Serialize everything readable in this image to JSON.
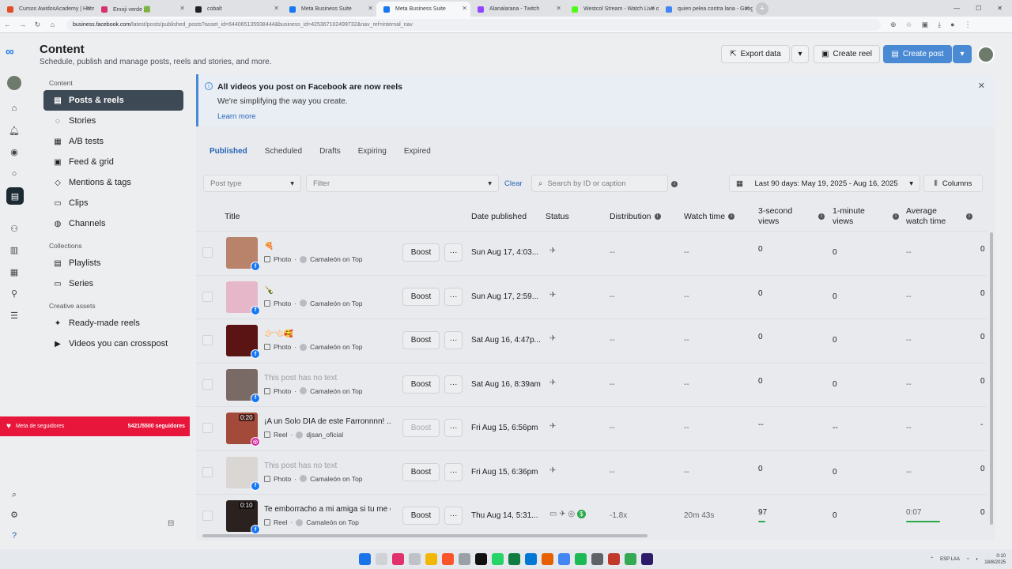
{
  "browser": {
    "tabs": [
      {
        "title": "Cursos AwidosAcademy | Hotm",
        "color": "#e34c26"
      },
      {
        "title": "Emoji verde 🟩",
        "color": "#d6336c"
      },
      {
        "title": "cobalt",
        "color": "#222222"
      },
      {
        "title": "Meta Business Suite",
        "color": "#1877f2"
      },
      {
        "title": "Meta Business Suite",
        "color": "#1877f2",
        "active": true
      },
      {
        "title": "Alanalarana - Twitch",
        "color": "#9146ff"
      },
      {
        "title": "Westcol Stream - Watch Live o",
        "color": "#53fc18"
      },
      {
        "title": "quien pelea contra lana - Googl",
        "color": "#4285f4"
      }
    ],
    "url_host": "business.facebook.com",
    "url_path": "/latest/posts/published_posts?asset_id=644065135938444&business_id=425367102499732&nav_ref=internal_nav"
  },
  "header": {
    "title": "Content",
    "subtitle": "Schedule, publish and manage posts, reels and stories, and more.",
    "export_label": "Export data",
    "create_reel_label": "Create reel",
    "create_post_label": "Create post"
  },
  "sidebar": {
    "group_content": "Content",
    "items_content": [
      {
        "label": "Posts & reels",
        "icon": "posts-icon",
        "active": true
      },
      {
        "label": "Stories",
        "icon": "stories-icon"
      },
      {
        "label": "A/B tests",
        "icon": "ab-test-icon"
      },
      {
        "label": "Feed & grid",
        "icon": "grid-icon"
      },
      {
        "label": "Mentions & tags",
        "icon": "tag-icon"
      },
      {
        "label": "Clips",
        "icon": "clips-icon"
      },
      {
        "label": "Channels",
        "icon": "channels-icon"
      }
    ],
    "group_collections": "Collections",
    "items_collections": [
      {
        "label": "Playlists",
        "icon": "playlist-icon"
      },
      {
        "label": "Series",
        "icon": "series-icon"
      }
    ],
    "group_creative": "Creative assets",
    "items_creative": [
      {
        "label": "Ready-made reels",
        "icon": "magic-icon"
      },
      {
        "label": "Videos you can crosspost",
        "icon": "video-icon"
      }
    ]
  },
  "overlay": {
    "label": "Meta de seguidores",
    "count": "5421/5500 seguidores"
  },
  "notice": {
    "title": "All videos you post on Facebook are now reels",
    "body": "We're simplifying the way you create.",
    "link": "Learn more"
  },
  "tabs": [
    "Published",
    "Scheduled",
    "Drafts",
    "Expiring",
    "Expired"
  ],
  "filters": {
    "post_type_placeholder": "Post type",
    "filter_placeholder": "Filter",
    "clear_label": "Clear",
    "search_placeholder": "Search by ID or caption",
    "date_range": "Last 90 days: May 19, 2025 - Aug 16, 2025",
    "columns_label": "Columns"
  },
  "table": {
    "columns": {
      "title": "Title",
      "date": "Date published",
      "status": "Status",
      "distribution": "Distribution",
      "watch_time": "Watch time",
      "views3": "3-second views",
      "views1m": "1-minute views",
      "avg_watch": "Average watch time"
    },
    "boost_label": "Boost",
    "rows": [
      {
        "title": "🍕",
        "type": "Photo",
        "account": "Camaleón on Top",
        "date": "Sun Aug 17, 4:03...",
        "distribution": "--",
        "watch_time": "--",
        "views3": "0",
        "views1m": "0",
        "avg_watch": "--",
        "last": "0",
        "thumb": "#b9826a",
        "platform": "fb"
      },
      {
        "title": "🍾",
        "type": "Photo",
        "account": "Camaleón on Top",
        "date": "Sun Aug 17, 2:59...",
        "distribution": "--",
        "watch_time": "--",
        "views3": "0",
        "views1m": "0",
        "avg_watch": "--",
        "last": "0",
        "thumb": "#e6b7c8",
        "platform": "fb"
      },
      {
        "title": "👉🏻👈🏻🥰",
        "type": "Photo",
        "account": "Camaleón on Top",
        "date": "Sat Aug 16, 4:47p...",
        "distribution": "--",
        "watch_time": "--",
        "views3": "0",
        "views1m": "0",
        "avg_watch": "--",
        "last": "0",
        "thumb": "#5a1414",
        "platform": "fb"
      },
      {
        "title": "This post has no text",
        "muted": true,
        "type": "Photo",
        "account": "Camaleón on Top",
        "date": "Sat Aug 16, 8:39am",
        "distribution": "--",
        "watch_time": "--",
        "views3": "0",
        "views1m": "0",
        "avg_watch": "--",
        "last": "0",
        "thumb": "#7a6a66",
        "platform": "fb"
      },
      {
        "title": "¡A un Solo DIA de este Farronnnn! ...",
        "type": "Reel",
        "account": "djsan_oficial",
        "date": "Fri Aug 15, 6:56pm",
        "distribution": "--",
        "watch_time": "--",
        "views3": "--",
        "views1m": "--",
        "avg_watch": "--",
        "last": "-",
        "thumb": "#a34a3a",
        "platform": "ig",
        "duration": "0:20",
        "boost_disabled": true
      },
      {
        "title": "This post has no text",
        "muted": true,
        "type": "Photo",
        "account": "Camaleón on Top",
        "date": "Fri Aug 15, 6:36pm",
        "distribution": "--",
        "watch_time": "--",
        "views3": "0",
        "views1m": "0",
        "avg_watch": "--",
        "last": "0",
        "thumb": "#d9d6d4",
        "platform": "fb"
      },
      {
        "title": "Te emborracho a mi amiga si tu me e...",
        "type": "Reel",
        "account": "Camaleón on Top",
        "date": "Thu Aug 14, 5:31...",
        "distribution": "-1.8x",
        "watch_time": "20m 43s",
        "views3": "97",
        "views1m": "0",
        "avg_watch": "0:07",
        "last": "0",
        "thumb": "#2b2220",
        "platform": "fb",
        "duration": "0:10",
        "rich_status": true
      }
    ]
  },
  "taskbar": {
    "lang": "ESP LAA",
    "time": "0:10",
    "date": "18/8/2025"
  }
}
